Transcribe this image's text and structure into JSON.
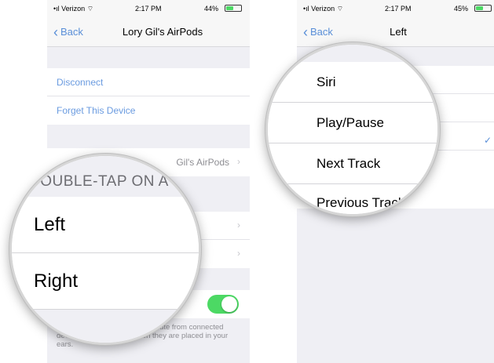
{
  "left_screen": {
    "status": {
      "carrier": "Verizon",
      "time": "2:17 PM",
      "battery": "44%"
    },
    "nav": {
      "back": "Back",
      "title": "Lory Gil's AirPods"
    },
    "actions": {
      "disconnect": "Disconnect",
      "forget": "Forget This Device"
    },
    "name_row": {
      "value": "Gil's AirPods"
    },
    "footer": "the audio route from connected devices to the AirPods when they are placed in your ears.",
    "footer_prefix": "Au",
    "magnifier": {
      "header": "DOUBLE-TAP ON A",
      "left": "Left",
      "right": "Right"
    }
  },
  "right_screen": {
    "status": {
      "carrier": "Verizon",
      "time": "2:17 PM",
      "battery": "45%"
    },
    "nav": {
      "back": "Back",
      "title": "Left"
    },
    "magnifier": {
      "options": [
        "Siri",
        "Play/Pause",
        "Next Track",
        "Previous Track"
      ]
    }
  },
  "colors": {
    "link": "#6a9be0",
    "toggle_on": "#4cd964",
    "background": "#efeff4"
  }
}
